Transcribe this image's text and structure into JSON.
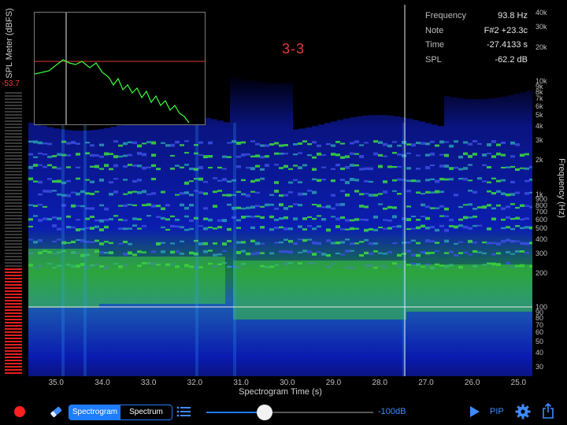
{
  "spl_meter": {
    "title": "SPL Meter (dBFS)",
    "value": "-53.7",
    "level_fraction": 0.38
  },
  "overlay": {
    "marker_label": "3-3",
    "readout": [
      {
        "key": "Frequency",
        "value": "93.8 Hz"
      },
      {
        "key": "Note",
        "value": "F#2 +23.3c"
      },
      {
        "key": "Time",
        "value": "-27.4133 s"
      },
      {
        "key": "SPL",
        "value": "-62.2 dB"
      }
    ]
  },
  "frequency_axis": {
    "label": "Frequency (Hz)",
    "ticks": [
      "40k",
      "30k",
      "20k",
      "10k",
      "9k",
      "8k",
      "7k",
      "6k",
      "5k",
      "4k",
      "3k",
      "2k",
      "1k",
      "900",
      "800",
      "700",
      "600",
      "500",
      "400",
      "300",
      "200",
      "100",
      "90",
      "80",
      "70",
      "60",
      "50",
      "40",
      "30"
    ]
  },
  "time_axis": {
    "label": "Spectrogram Time (s)",
    "ticks": [
      "35.0",
      "34.0",
      "33.0",
      "32.0",
      "31.0",
      "30.0",
      "29.0",
      "28.0",
      "27.0",
      "26.0",
      "25.0"
    ]
  },
  "toolbar": {
    "segments": [
      "Spectrogram",
      "Spectrum"
    ],
    "selected_segment": "Spectrogram",
    "threshold_label": "-100dB",
    "threshold_fraction": 0.35,
    "pip_label": "PIP"
  },
  "colors": {
    "accent": "#1e7cff",
    "record": "#ff2020",
    "meter_red": "#e02020",
    "spectrogram_low": "#0a1aa0",
    "spectrogram_high": "#3cff3c",
    "marker_label": "#e23a3a"
  },
  "icons": [
    "record-icon",
    "eraser-icon",
    "list-icon",
    "play-icon",
    "gear-icon",
    "share-icon"
  ]
}
